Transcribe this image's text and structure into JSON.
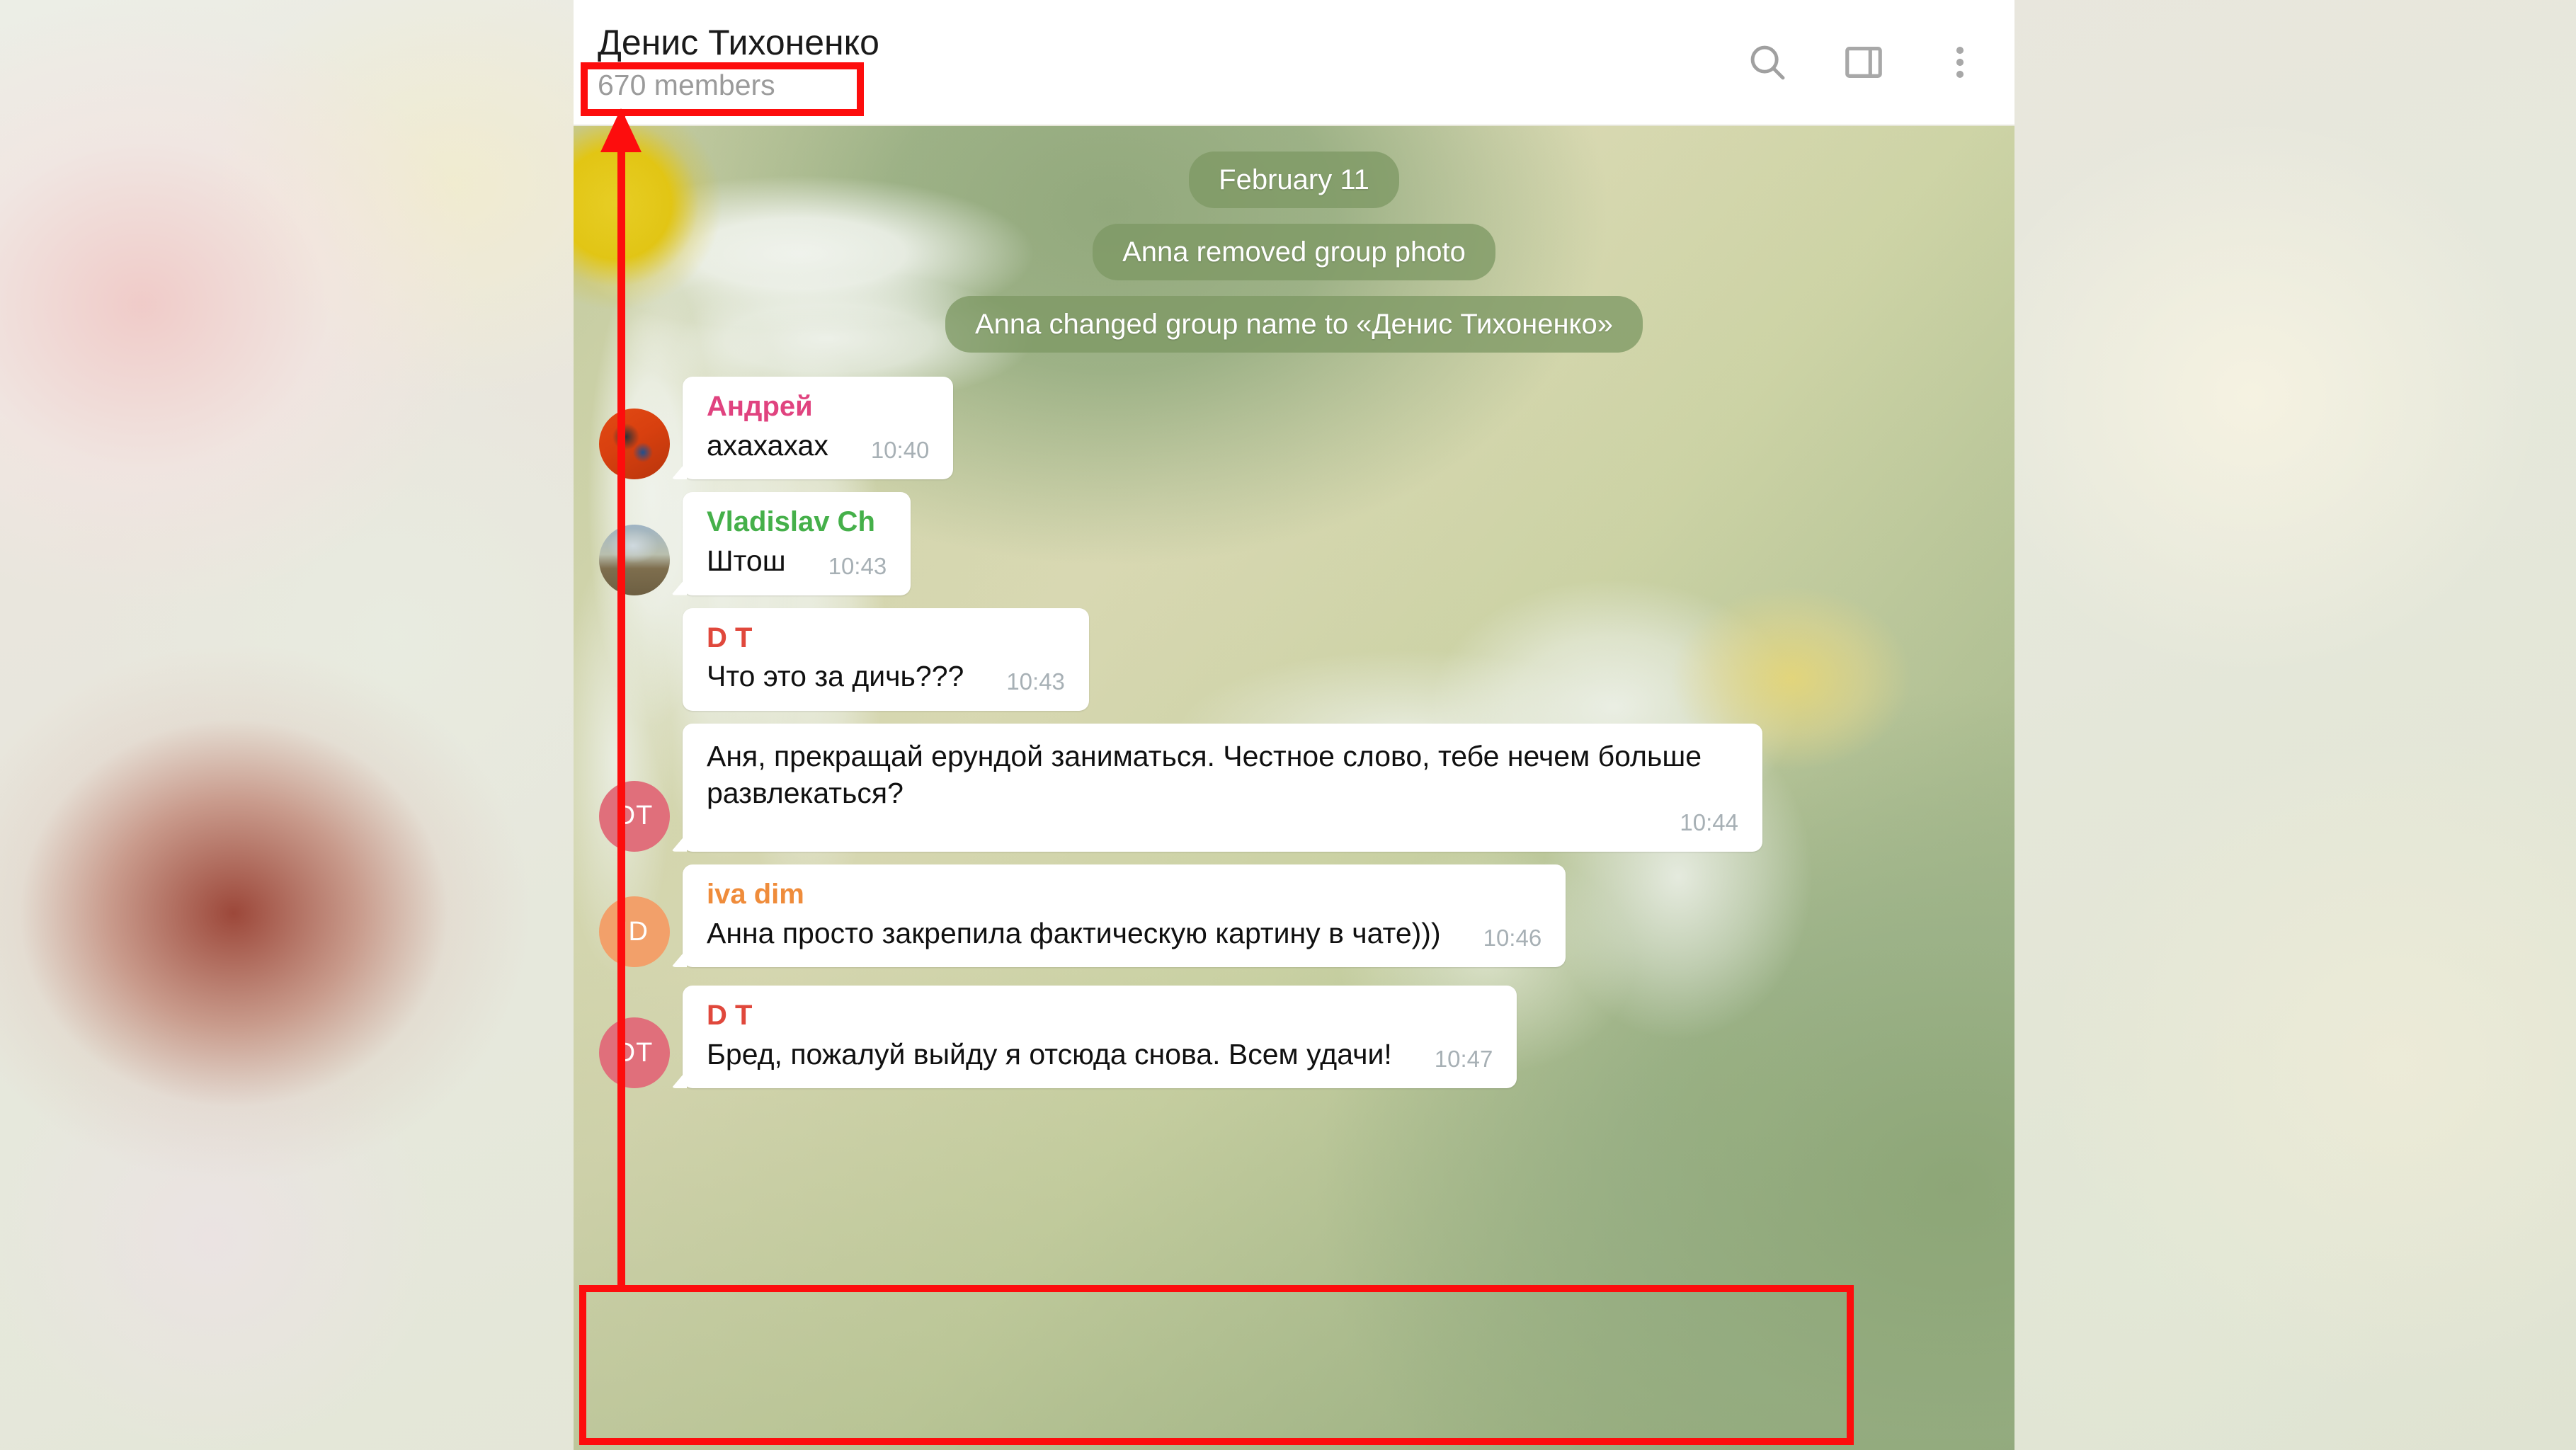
{
  "app": {
    "name": "telegram-chat"
  },
  "header": {
    "title": "Денис Тихоненко",
    "subtitle": "670 members",
    "actions": [
      {
        "name": "search-icon",
        "label": "Search"
      },
      {
        "name": "sidebar-panel-icon",
        "label": "Toggle info panel"
      },
      {
        "name": "more-options-icon",
        "label": "More"
      }
    ]
  },
  "service_messages": [
    {
      "text": "February 11"
    },
    {
      "text": "Anna removed group photo"
    },
    {
      "text": "Anna changed group name to «Денис Тихоненко»"
    }
  ],
  "messages": [
    {
      "sender": "Андрей",
      "sender_color": "#e0437f",
      "text": "ахахахах",
      "time": "10:40",
      "avatar": {
        "type": "photo",
        "style": "photo-andrey",
        "initials": ""
      }
    },
    {
      "sender": "Vladislav Ch",
      "sender_color": "#45b04a",
      "text": "Штош",
      "time": "10:43",
      "avatar": {
        "type": "photo",
        "style": "photo-vlad",
        "initials": ""
      }
    },
    {
      "sender": "D T",
      "sender_color": "#e0483c",
      "text": "Что это за дичь???",
      "time": "10:43",
      "avatar": {
        "type": "none",
        "style": "",
        "initials": ""
      }
    },
    {
      "sender": "",
      "sender_color": "#e0483c",
      "text": "Аня, прекращай ерундой заниматься. Честное слово, тебе нечем больше развлекаться?",
      "time": "10:44",
      "avatar": {
        "type": "initials",
        "style": "",
        "initials": "DT",
        "color": "#e06f7b"
      }
    },
    {
      "sender": "iva dim",
      "sender_color": "#ef8c3b",
      "text": "Анна просто закрепила фактическую картину в чате)))",
      "time": "10:46",
      "avatar": {
        "type": "initials",
        "style": "",
        "initials": "ID",
        "color": "#f2a06a"
      }
    },
    {
      "sender": "D T",
      "sender_color": "#e0483c",
      "text": "Бред, пожалуй выйду я отсюда снова. Всем удачи!",
      "time": "10:47",
      "avatar": {
        "type": "initials",
        "style": "",
        "initials": "DT",
        "color": "#e06f7b"
      }
    }
  ],
  "annotations": {
    "color": "#fd0d0d",
    "highlight_members": "670 members",
    "highlight_last_message": "Бред, пожалуй выйду я отсюда снова. Всем удачи!"
  }
}
